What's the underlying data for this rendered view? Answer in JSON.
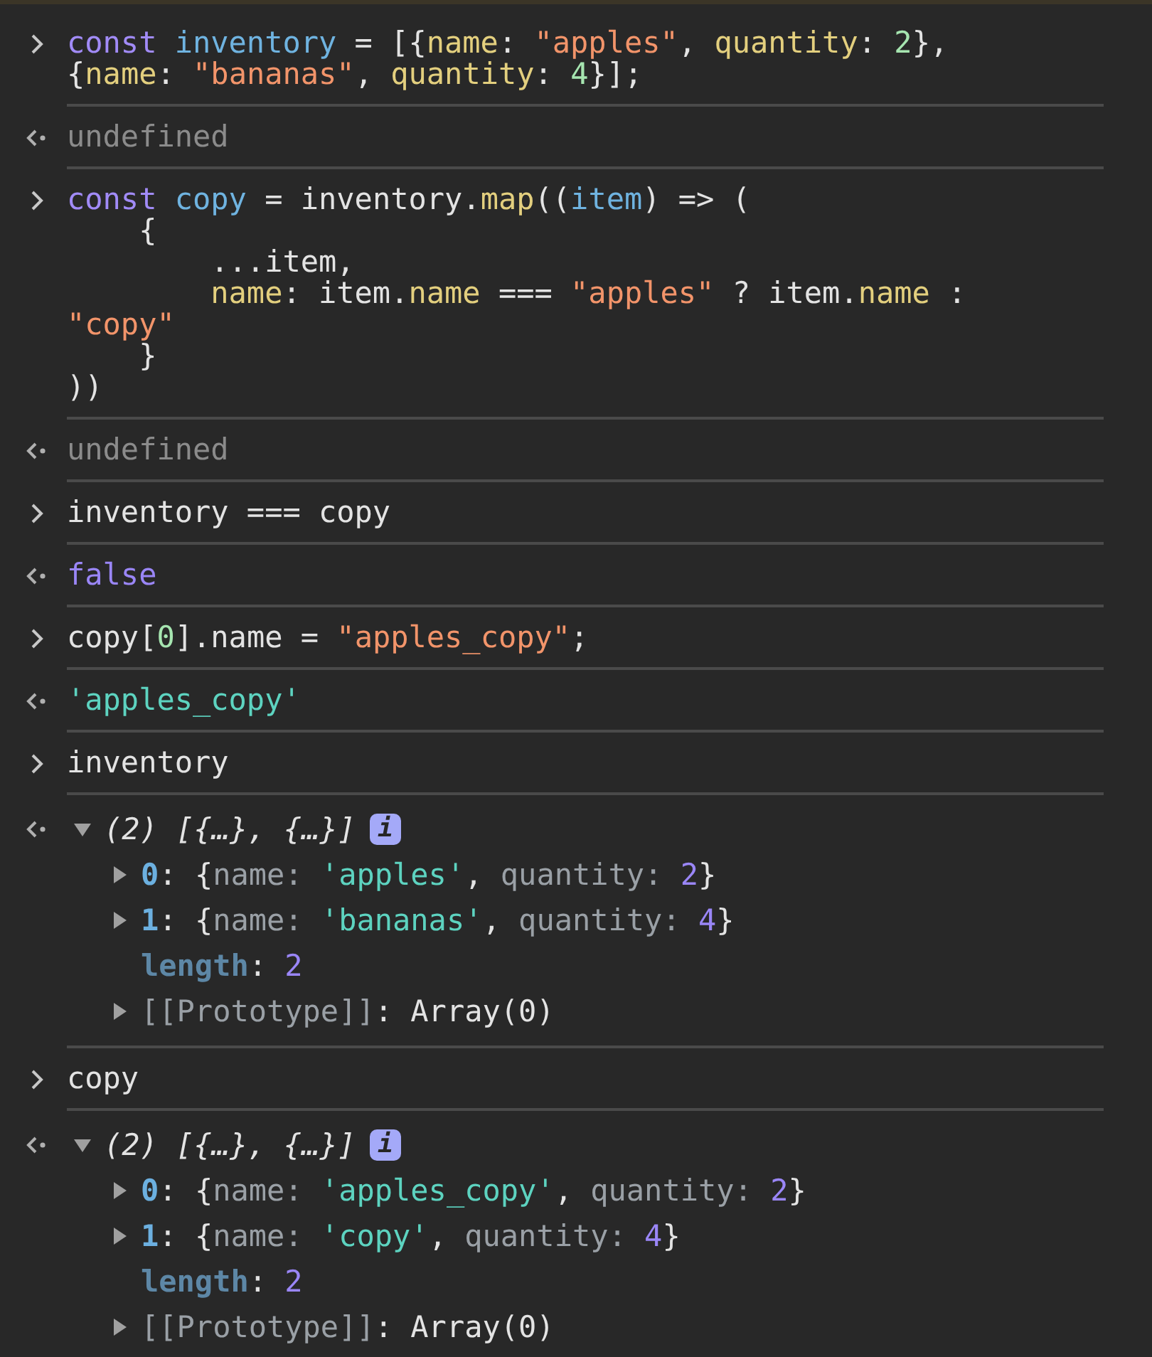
{
  "entries": [
    {
      "kind": "input",
      "lines": [
        [
          {
            "kind": "keyword",
            "text": "const "
          },
          {
            "kind": "definition",
            "text": "inventory"
          },
          {
            "kind": "plain",
            "text": " = [{"
          },
          {
            "kind": "property",
            "text": "name"
          },
          {
            "kind": "plain",
            "text": ": "
          },
          {
            "kind": "string",
            "text": "\"apples\""
          },
          {
            "kind": "plain",
            "text": ", "
          },
          {
            "kind": "property",
            "text": "quantity"
          },
          {
            "kind": "plain",
            "text": ": "
          },
          {
            "kind": "number",
            "text": "2"
          },
          {
            "kind": "plain",
            "text": "},"
          }
        ],
        [
          {
            "kind": "plain",
            "text": "{"
          },
          {
            "kind": "property",
            "text": "name"
          },
          {
            "kind": "plain",
            "text": ": "
          },
          {
            "kind": "string",
            "text": "\"bananas\""
          },
          {
            "kind": "plain",
            "text": ", "
          },
          {
            "kind": "property",
            "text": "quantity"
          },
          {
            "kind": "plain",
            "text": ": "
          },
          {
            "kind": "number",
            "text": "4"
          },
          {
            "kind": "plain",
            "text": "}];"
          }
        ]
      ]
    },
    {
      "kind": "result",
      "lines": [
        [
          {
            "kind": "nothing",
            "text": "undefined"
          }
        ]
      ]
    },
    {
      "kind": "input",
      "lines": [
        [
          {
            "kind": "keyword",
            "text": "const "
          },
          {
            "kind": "definition",
            "text": "copy"
          },
          {
            "kind": "plain",
            "text": " = inventory."
          },
          {
            "kind": "property",
            "text": "map"
          },
          {
            "kind": "plain",
            "text": "(("
          },
          {
            "kind": "definition",
            "text": "item"
          },
          {
            "kind": "plain",
            "text": ") => ("
          }
        ],
        [
          {
            "kind": "plain",
            "text": "    {"
          }
        ],
        [
          {
            "kind": "plain",
            "text": "        ...item,"
          }
        ],
        [
          {
            "kind": "property",
            "text": "        name"
          },
          {
            "kind": "plain",
            "text": ": item."
          },
          {
            "kind": "property",
            "text": "name"
          },
          {
            "kind": "plain",
            "text": " === "
          },
          {
            "kind": "string",
            "text": "\"apples\""
          },
          {
            "kind": "plain",
            "text": " ? item."
          },
          {
            "kind": "property",
            "text": "name"
          },
          {
            "kind": "plain",
            "text": " :"
          }
        ],
        [
          {
            "kind": "string",
            "text": "\"copy\""
          }
        ],
        [
          {
            "kind": "plain",
            "text": "    }"
          }
        ],
        [
          {
            "kind": "plain",
            "text": "))"
          }
        ]
      ]
    },
    {
      "kind": "result",
      "lines": [
        [
          {
            "kind": "nothing",
            "text": "undefined"
          }
        ]
      ]
    },
    {
      "kind": "input",
      "lines": [
        [
          {
            "kind": "plain",
            "text": "inventory === copy"
          }
        ]
      ]
    },
    {
      "kind": "result",
      "lines": [
        [
          {
            "kind": "boolean",
            "text": "false"
          }
        ]
      ]
    },
    {
      "kind": "input",
      "lines": [
        [
          {
            "kind": "plain",
            "text": "copy["
          },
          {
            "kind": "number",
            "text": "0"
          },
          {
            "kind": "plain",
            "text": "].name = "
          },
          {
            "kind": "string",
            "text": "\"apples_copy\""
          },
          {
            "kind": "plain",
            "text": ";"
          }
        ]
      ]
    },
    {
      "kind": "result",
      "lines": [
        [
          {
            "kind": "literal",
            "text": "'apples_copy'"
          }
        ]
      ]
    },
    {
      "kind": "input",
      "lines": [
        [
          {
            "kind": "plain",
            "text": "inventory"
          }
        ]
      ]
    },
    {
      "kind": "object",
      "expanded": true,
      "summary": "(2) [{…}, {…}]",
      "badge": "i",
      "children": [
        {
          "kind": "node",
          "expanded": false,
          "tokens": [
            {
              "kind": "index",
              "text": "0"
            },
            {
              "kind": "plain",
              "text": ": {"
            },
            {
              "kind": "key",
              "text": "name: "
            },
            {
              "kind": "literal",
              "text": "'apples'"
            },
            {
              "kind": "plain",
              "text": ", "
            },
            {
              "kind": "key",
              "text": "quantity: "
            },
            {
              "kind": "count",
              "text": "2"
            },
            {
              "kind": "plain",
              "text": "}"
            }
          ]
        },
        {
          "kind": "node",
          "expanded": false,
          "tokens": [
            {
              "kind": "index",
              "text": "1"
            },
            {
              "kind": "plain",
              "text": ": {"
            },
            {
              "kind": "key",
              "text": "name: "
            },
            {
              "kind": "literal",
              "text": "'bananas'"
            },
            {
              "kind": "plain",
              "text": ", "
            },
            {
              "kind": "key",
              "text": "quantity: "
            },
            {
              "kind": "count",
              "text": "4"
            },
            {
              "kind": "plain",
              "text": "}"
            }
          ]
        },
        {
          "kind": "property",
          "tokens": [
            {
              "kind": "length",
              "text": "length"
            },
            {
              "kind": "plain",
              "text": ": "
            },
            {
              "kind": "count",
              "text": "2"
            }
          ]
        },
        {
          "kind": "node",
          "expanded": false,
          "tokens": [
            {
              "kind": "key",
              "text": "[[Prototype]]"
            },
            {
              "kind": "plain",
              "text": ": Array(0)"
            }
          ]
        }
      ]
    },
    {
      "kind": "input",
      "lines": [
        [
          {
            "kind": "plain",
            "text": "copy"
          }
        ]
      ]
    },
    {
      "kind": "object",
      "expanded": true,
      "summary": "(2) [{…}, {…}]",
      "badge": "i",
      "children": [
        {
          "kind": "node",
          "expanded": false,
          "tokens": [
            {
              "kind": "index",
              "text": "0"
            },
            {
              "kind": "plain",
              "text": ": {"
            },
            {
              "kind": "key",
              "text": "name: "
            },
            {
              "kind": "literal",
              "text": "'apples_copy'"
            },
            {
              "kind": "plain",
              "text": ", "
            },
            {
              "kind": "key",
              "text": "quantity: "
            },
            {
              "kind": "count",
              "text": "2"
            },
            {
              "kind": "plain",
              "text": "}"
            }
          ]
        },
        {
          "kind": "node",
          "expanded": false,
          "tokens": [
            {
              "kind": "index",
              "text": "1"
            },
            {
              "kind": "plain",
              "text": ": {"
            },
            {
              "kind": "key",
              "text": "name: "
            },
            {
              "kind": "literal",
              "text": "'copy'"
            },
            {
              "kind": "plain",
              "text": ", "
            },
            {
              "kind": "key",
              "text": "quantity: "
            },
            {
              "kind": "count",
              "text": "4"
            },
            {
              "kind": "plain",
              "text": "}"
            }
          ]
        },
        {
          "kind": "property",
          "tokens": [
            {
              "kind": "length",
              "text": "length"
            },
            {
              "kind": "plain",
              "text": ": "
            },
            {
              "kind": "count",
              "text": "2"
            }
          ]
        },
        {
          "kind": "node",
          "expanded": false,
          "tokens": [
            {
              "kind": "key",
              "text": "[[Prototype]]"
            },
            {
              "kind": "plain",
              "text": ": Array(0)"
            }
          ]
        }
      ]
    }
  ]
}
